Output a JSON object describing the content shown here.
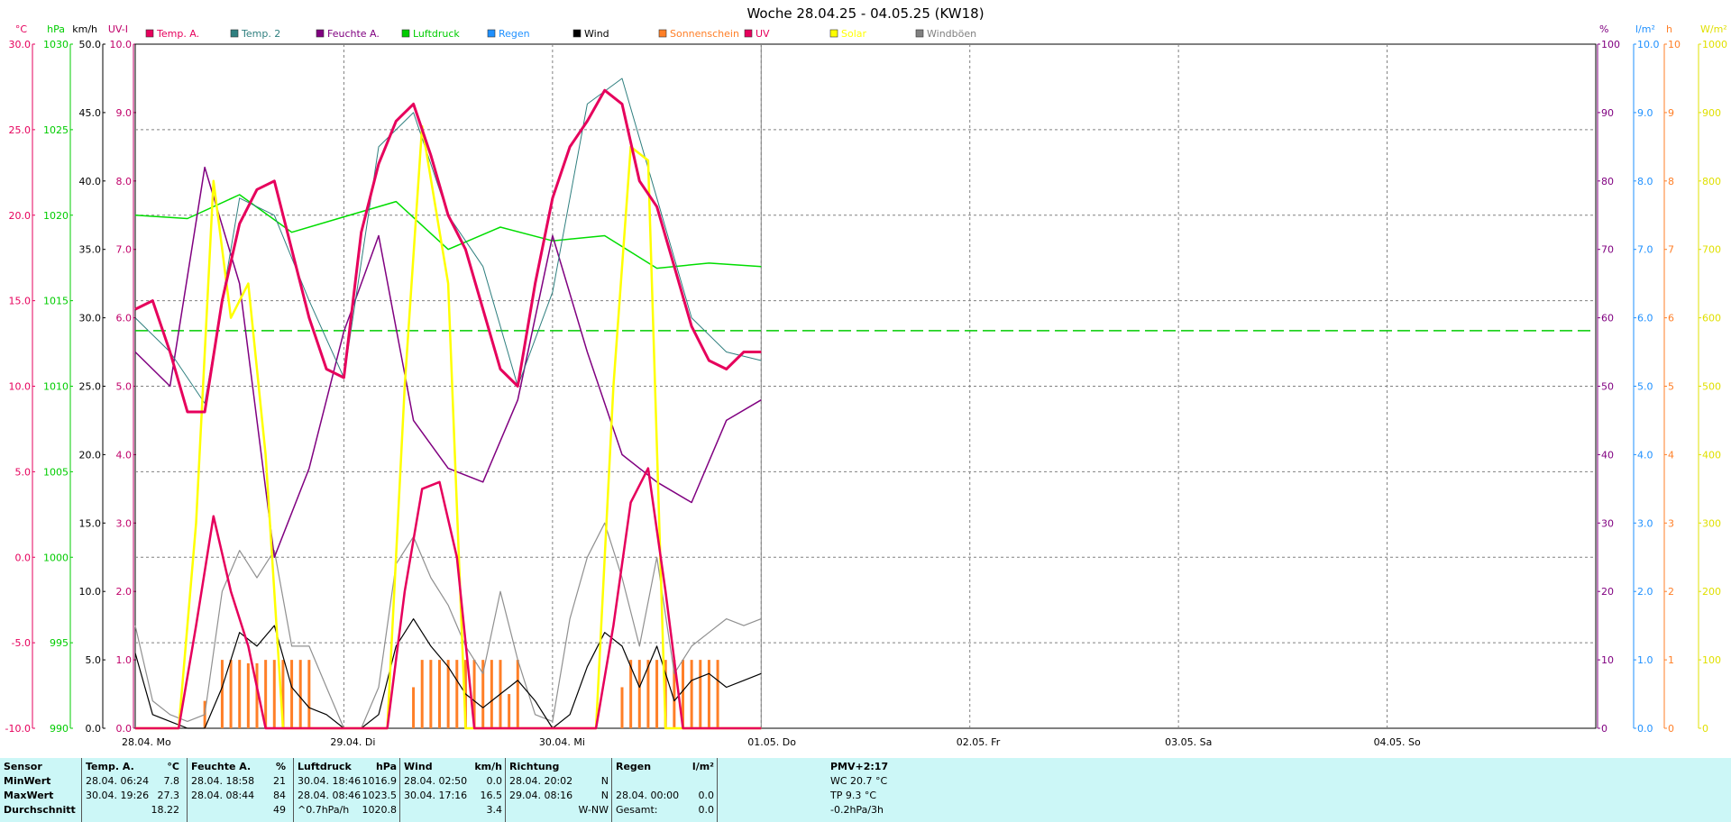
{
  "title": "Woche 28.04.25 - 04.05.25 (KW18)",
  "axes": {
    "temp": {
      "unit": "°C",
      "color": "#e6005c",
      "ticks": [
        "30.0",
        "25.0",
        "20.0",
        "15.0",
        "10.0",
        "5.0",
        "0.0",
        "-5.0",
        "-10.0"
      ]
    },
    "pressure": {
      "unit": "hPa",
      "color": "#00cc00",
      "ticks": [
        "1030",
        "1025",
        "1020",
        "1015",
        "1010",
        "1005",
        "1000",
        "995",
        "990"
      ]
    },
    "wind": {
      "unit": "km/h",
      "color": "#000000",
      "ticks": [
        "50.0",
        "45.0",
        "40.0",
        "35.0",
        "30.0",
        "25.0",
        "20.0",
        "15.0",
        "10.0",
        "5.0",
        "0.0"
      ]
    },
    "uv": {
      "unit": "UV-I",
      "color": "#c0006a",
      "ticks": [
        "10.0",
        "9.0",
        "8.0",
        "7.0",
        "6.0",
        "5.0",
        "4.0",
        "3.0",
        "2.0",
        "1.0",
        "0.0"
      ]
    },
    "humidity": {
      "unit": "%",
      "color": "#800080",
      "ticks": [
        "100",
        "90",
        "80",
        "70",
        "60",
        "50",
        "40",
        "30",
        "20",
        "10",
        "0"
      ]
    },
    "rain": {
      "unit": "l/m²",
      "color": "#1e90ff",
      "ticks": [
        "10.0",
        "9.0",
        "8.0",
        "7.0",
        "6.0",
        "5.0",
        "4.0",
        "3.0",
        "2.0",
        "1.0",
        "0.0"
      ]
    },
    "sunshine": {
      "unit": "h",
      "color": "#ff7f27",
      "ticks": [
        "10",
        "9",
        "8",
        "7",
        "6",
        "5",
        "4",
        "3",
        "2",
        "1",
        "0"
      ]
    },
    "solar": {
      "unit": "W/m²",
      "color": "#e0e000",
      "ticks": [
        "1000",
        "900",
        "800",
        "700",
        "600",
        "500",
        "400",
        "300",
        "200",
        "100",
        "0"
      ]
    }
  },
  "legend": [
    {
      "label": "Temp. A.",
      "color": "#e6005c"
    },
    {
      "label": "Temp. 2",
      "color": "#2f7f7f"
    },
    {
      "label": "Feuchte A.",
      "color": "#800080"
    },
    {
      "label": "Luftdruck",
      "color": "#00cc00"
    },
    {
      "label": "Regen",
      "color": "#1e90ff"
    },
    {
      "label": "Wind",
      "color": "#000000"
    },
    {
      "label": "Sonnenschein",
      "color": "#ff7f27"
    },
    {
      "label": "UV",
      "color": "#e6005c"
    },
    {
      "label": "Solar",
      "color": "#ffff00"
    },
    {
      "label": "Windböen",
      "color": "#808080"
    }
  ],
  "chart_data": {
    "type": "line",
    "title": "Woche 28.04.25 - 04.05.25 (KW18)",
    "x_labels": [
      "28.04. Mo",
      "29.04. Di",
      "30.04. Mi",
      "01.05. Do",
      "02.05. Fr",
      "03.05. Sa",
      "04.05. So"
    ],
    "x_range_hours": [
      0,
      168
    ],
    "grid": true,
    "reference_lines": {
      "pressure_hpa": 1013.25
    },
    "series": [
      {
        "name": "Temp. A.",
        "axis": "temp",
        "x": [
          0,
          2,
          4,
          6,
          8,
          10,
          12,
          14,
          16,
          18,
          20,
          22,
          24,
          26,
          28,
          30,
          32,
          34,
          36,
          38,
          40,
          42,
          44,
          46,
          48,
          50,
          52,
          54,
          56,
          58,
          60,
          62,
          64,
          66,
          68,
          70,
          72
        ],
        "y": [
          14.5,
          15.0,
          12.0,
          8.5,
          8.5,
          15.0,
          19.5,
          21.5,
          22.0,
          18.0,
          14.0,
          11.0,
          10.5,
          19.0,
          23.0,
          25.5,
          26.5,
          23.5,
          20.0,
          18.0,
          14.5,
          11.0,
          10.0,
          16.0,
          21.0,
          24.0,
          25.5,
          27.3,
          26.5,
          22.0,
          20.5,
          17.0,
          13.5,
          11.5,
          11.0,
          12.0,
          12.0
        ],
        "approx_from_plot": true
      },
      {
        "name": "Temp. 2",
        "axis": "temp",
        "x": [
          0,
          4,
          8,
          12,
          16,
          20,
          24,
          28,
          32,
          36,
          40,
          44,
          48,
          52,
          56,
          60,
          64,
          68,
          72
        ],
        "y": [
          14.0,
          12.0,
          9.0,
          21.0,
          20.0,
          15.0,
          10.5,
          24.0,
          26.0,
          20.0,
          17.0,
          10.0,
          15.5,
          26.5,
          28.0,
          21.0,
          14.0,
          12.0,
          11.5
        ],
        "approx_from_plot": true
      },
      {
        "name": "Feuchte A.",
        "axis": "humidity",
        "x": [
          0,
          4,
          8,
          12,
          16,
          20,
          24,
          28,
          32,
          36,
          40,
          44,
          48,
          52,
          56,
          60,
          64,
          68,
          72
        ],
        "y": [
          55,
          50,
          82,
          65,
          25,
          38,
          58,
          72,
          45,
          38,
          36,
          48,
          72,
          55,
          40,
          36,
          33,
          45,
          48
        ],
        "approx_from_plot": true
      },
      {
        "name": "Luftdruck",
        "axis": "pressure",
        "x": [
          0,
          6,
          12,
          18,
          24,
          30,
          36,
          42,
          48,
          54,
          60,
          66,
          72
        ],
        "y": [
          1020.0,
          1019.8,
          1021.2,
          1019.0,
          1019.9,
          1020.8,
          1018.0,
          1019.3,
          1018.5,
          1018.8,
          1016.9,
          1017.2,
          1017.0
        ],
        "approx_from_plot": true
      },
      {
        "name": "Solar",
        "axis": "solar",
        "x": [
          0,
          5,
          7,
          9,
          11,
          13,
          15,
          17,
          19,
          21,
          24,
          29,
          31,
          33,
          36,
          38,
          40,
          44,
          53,
          55,
          57,
          59,
          61,
          63,
          65,
          67,
          72
        ],
        "y": [
          0,
          0,
          300,
          800,
          600,
          650,
          400,
          0,
          0,
          0,
          0,
          0,
          500,
          880,
          650,
          0,
          0,
          0,
          0,
          500,
          850,
          830,
          0,
          0,
          0,
          0,
          0
        ],
        "approx_from_plot": true
      },
      {
        "name": "UV",
        "axis": "uv",
        "x": [
          0,
          5,
          7,
          9,
          11,
          13,
          15,
          17,
          24,
          29,
          31,
          33,
          35,
          37,
          39,
          44,
          53,
          55,
          57,
          59,
          61,
          63,
          72
        ],
        "y": [
          0,
          0,
          1.5,
          3.1,
          2.0,
          1.2,
          0,
          0,
          0,
          0,
          2.0,
          3.5,
          3.6,
          2.5,
          0,
          0,
          0,
          1.5,
          3.3,
          3.8,
          2.0,
          0,
          0
        ],
        "approx_from_plot": true
      },
      {
        "name": "Wind",
        "axis": "wind",
        "x": [
          0,
          2,
          4,
          6,
          8,
          10,
          12,
          14,
          16,
          18,
          20,
          22,
          24,
          26,
          28,
          30,
          32,
          34,
          36,
          38,
          40,
          42,
          44,
          46,
          48,
          50,
          52,
          54,
          56,
          58,
          60,
          62,
          64,
          66,
          68,
          70,
          72
        ],
        "y": [
          5.5,
          1.0,
          0.5,
          0.0,
          0.0,
          3.0,
          7.0,
          6.0,
          7.5,
          3.0,
          1.5,
          1.0,
          0.0,
          0.0,
          1.0,
          6.0,
          8.0,
          6.0,
          4.5,
          2.5,
          1.5,
          2.5,
          3.5,
          2.0,
          0.0,
          1.0,
          4.5,
          7.0,
          6.0,
          3.0,
          6.0,
          2.0,
          3.5,
          4.0,
          3.0,
          3.5,
          4.0
        ],
        "approx_from_plot": true
      },
      {
        "name": "Windböen",
        "axis": "wind",
        "x": [
          0,
          2,
          4,
          6,
          8,
          10,
          12,
          14,
          16,
          18,
          20,
          22,
          24,
          26,
          28,
          30,
          32,
          34,
          36,
          38,
          40,
          42,
          44,
          46,
          48,
          50,
          52,
          54,
          56,
          58,
          60,
          62,
          64,
          66,
          68,
          70,
          72
        ],
        "y": [
          7.5,
          2.0,
          1.0,
          0.5,
          1.0,
          10.0,
          13.0,
          11.0,
          13.0,
          6.0,
          6.0,
          3.0,
          0.0,
          0.0,
          3.0,
          12.0,
          14.0,
          11.0,
          9.0,
          6.0,
          4.0,
          10.0,
          5.0,
          1.0,
          0.5,
          8.0,
          12.5,
          15.0,
          11.0,
          6.0,
          12.5,
          4.0,
          6.0,
          7.0,
          8.0,
          7.5,
          8.0
        ],
        "approx_from_plot": true
      },
      {
        "name": "Sonnenschein",
        "axis": "sunshine",
        "type": "bar",
        "x": [
          8,
          10,
          11,
          12,
          13,
          14,
          15,
          16,
          17,
          18,
          19,
          20,
          32,
          33,
          34,
          35,
          36,
          37,
          38,
          39,
          40,
          41,
          42,
          43,
          44,
          56,
          57,
          58,
          59,
          60,
          61,
          62,
          63,
          64,
          65,
          66,
          67
        ],
        "y": [
          0.4,
          1.0,
          1.0,
          1.0,
          0.95,
          0.95,
          1.0,
          1.0,
          1.0,
          1.0,
          1.0,
          1.0,
          0.6,
          1.0,
          1.0,
          1.0,
          1.0,
          1.0,
          1.0,
          1.0,
          1.0,
          1.0,
          1.0,
          0.5,
          1.0,
          0.6,
          1.0,
          1.0,
          1.0,
          1.0,
          1.0,
          1.0,
          1.0,
          1.0,
          1.0,
          1.0,
          1.0
        ],
        "approx_from_plot": true
      }
    ]
  },
  "stats": {
    "sensor": {
      "header": "Sensor",
      "rows": [
        "MinWert",
        "MaxWert",
        "Durchschnitt"
      ]
    },
    "temp": {
      "header": "Temp. A.",
      "unit": "°C",
      "rows": [
        [
          "28.04.  06:24",
          "7.8"
        ],
        [
          "30.04.  19:26",
          "27.3"
        ],
        [
          "",
          "18.22"
        ]
      ]
    },
    "humidity": {
      "header": "Feuchte A.",
      "unit": "%",
      "rows": [
        [
          "28.04.  18:58",
          "21"
        ],
        [
          "28.04.  08:44",
          "84"
        ],
        [
          "",
          "49"
        ]
      ]
    },
    "pressure": {
      "header": "Luftdruck",
      "unit": "hPa",
      "rows": [
        [
          "30.04.  18:46",
          "1016.9"
        ],
        [
          "28.04.  08:46",
          "1023.5"
        ],
        [
          "^0.7hPa/h",
          "1020.8"
        ]
      ]
    },
    "wind": {
      "header": "Wind",
      "unit": "km/h",
      "rows": [
        [
          "28.04.  02:50",
          "0.0"
        ],
        [
          "30.04.  17:16",
          "16.5"
        ],
        [
          "",
          "3.4"
        ]
      ]
    },
    "direction": {
      "header": "Richtung",
      "rows": [
        [
          "28.04.  20:02",
          "N"
        ],
        [
          "29.04.  08:16",
          "N"
        ],
        [
          "",
          "W-NW"
        ]
      ]
    },
    "rain": {
      "header": "Regen",
      "unit": "l/m²",
      "rows": [
        [
          "",
          ""
        ],
        [
          "28.04.  00:00",
          "0.0"
        ],
        [
          "Gesamt:",
          "0.0"
        ]
      ]
    },
    "extra": {
      "header": "PMV+2:17",
      "rows": [
        "WC 20.7 °C",
        "TP 9.3 °C",
        "-0.2hPa/3h"
      ]
    }
  }
}
